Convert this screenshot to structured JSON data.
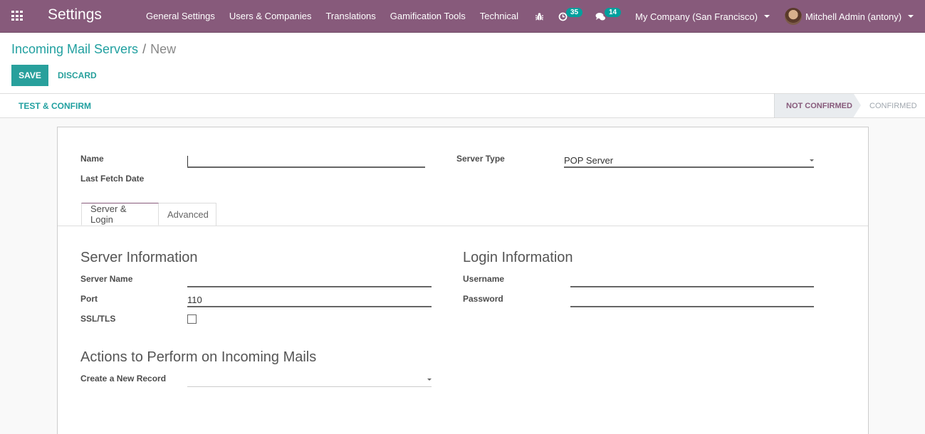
{
  "navbar": {
    "app_title": "Settings",
    "menu": [
      "General Settings",
      "Users & Companies",
      "Translations",
      "Gamification Tools",
      "Technical"
    ],
    "activity_count": "35",
    "messages_count": "14",
    "company": "My Company (San Francisco)",
    "user": "Mitchell Admin (antony)"
  },
  "breadcrumb": {
    "parent": "Incoming Mail Servers",
    "separator": "/",
    "current": "New"
  },
  "buttons": {
    "save": "SAVE",
    "discard": "DISCARD",
    "test_confirm": "TEST & CONFIRM"
  },
  "statusbar": {
    "stages": [
      "NOT CONFIRMED",
      "CONFIRMED"
    ],
    "active_stage": "NOT CONFIRMED"
  },
  "form": {
    "name_label": "Name",
    "name_value": "",
    "last_fetch_label": "Last Fetch Date",
    "server_type_label": "Server Type",
    "server_type_value": "POP Server",
    "tabs": [
      "Server & Login",
      "Advanced"
    ],
    "server_info": {
      "title": "Server Information",
      "server_name_label": "Server Name",
      "server_name_value": "",
      "port_label": "Port",
      "port_value": "110",
      "ssl_label": "SSL/TLS",
      "ssl_checked": false
    },
    "login_info": {
      "title": "Login Information",
      "username_label": "Username",
      "username_value": "",
      "password_label": "Password",
      "password_value": ""
    },
    "actions": {
      "title": "Actions to Perform on Incoming Mails",
      "create_record_label": "Create a New Record",
      "create_record_value": ""
    }
  }
}
